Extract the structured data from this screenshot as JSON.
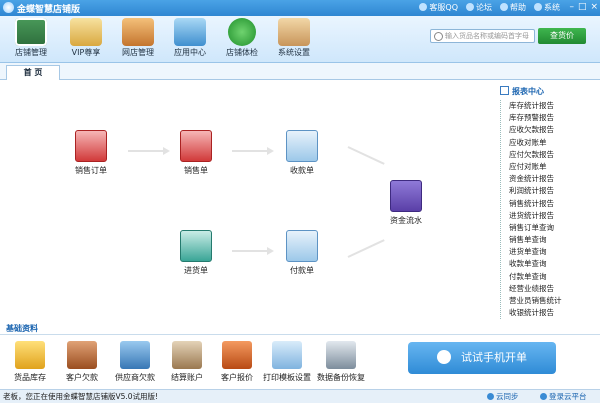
{
  "window": {
    "title": "金蝶智慧店铺版"
  },
  "title_links": [
    {
      "label": "客服QQ",
      "icon": "qq-icon"
    },
    {
      "label": "论坛",
      "icon": "forum-icon"
    },
    {
      "label": "帮助",
      "icon": "help-icon"
    },
    {
      "label": "系统",
      "icon": "gear-icon"
    }
  ],
  "window_buttons": {
    "minimize": "–",
    "maximize": "□",
    "close": "×"
  },
  "toolbar": {
    "items": [
      {
        "label": "店铺管理",
        "icon": "store-manage-icon"
      },
      {
        "label": "VIP尊享",
        "icon": "vip-icon"
      },
      {
        "label": "网店管理",
        "icon": "online-store-icon"
      },
      {
        "label": "应用中心",
        "icon": "app-center-icon"
      },
      {
        "label": "店铺体检",
        "icon": "store-checkup-icon"
      },
      {
        "label": "系统设置",
        "icon": "settings-box-icon"
      }
    ],
    "search_placeholder": "输入货品名称或编码首字母",
    "search_button": "查货价"
  },
  "tabs": [
    {
      "label": "首 页"
    }
  ],
  "flow": {
    "sales_order": "销售订单",
    "sales_slip": "销售单",
    "receipt": "收款单",
    "purchase": "进货单",
    "payment": "付款单",
    "cashflow": "资金流水"
  },
  "reports": {
    "title": "报表中心",
    "items": [
      "库存统计报告",
      "库存预警报告",
      "应收欠款报告",
      "应收对账单",
      "应付欠款报告",
      "应付对账单",
      "资金统计报告",
      "利润统计报告",
      "销售统计报告",
      "进货统计报告",
      "销售订单查询",
      "销售单查询",
      "进货单查询",
      "收款单查询",
      "付款单查询",
      "经营业绩报告",
      "营业员销售统计",
      "收银统计报告"
    ]
  },
  "base": {
    "title": "基础资料",
    "items": [
      {
        "label": "货品库存",
        "icon": "goods-stock-icon"
      },
      {
        "label": "客户欠款",
        "icon": "customer-debt-icon"
      },
      {
        "label": "供应商欠款",
        "icon": "supplier-debt-icon"
      },
      {
        "label": "结算账户",
        "icon": "settle-account-icon"
      },
      {
        "label": "客户报价",
        "icon": "customer-quote-icon"
      },
      {
        "label": "打印模板设置",
        "icon": "printer-icon"
      },
      {
        "label": "数据备份恢复",
        "icon": "backup-icon"
      }
    ],
    "try_button": "试试手机开单"
  },
  "status": {
    "message": "老板，您正在使用金蝶智慧店铺版V5.0试用版!",
    "sync": "云同步",
    "login": "登录云平台"
  }
}
